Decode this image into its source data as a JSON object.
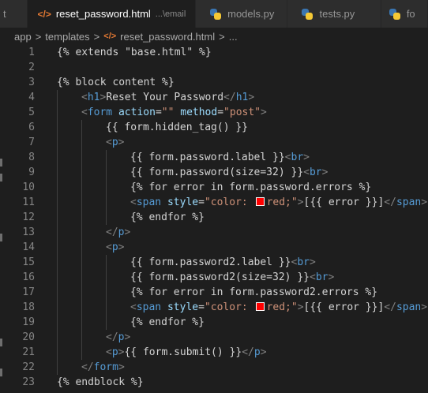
{
  "tabs": [
    {
      "label": "t",
      "icon": "",
      "hint": "",
      "active": false
    },
    {
      "label": "reset_password.html",
      "icon": "html-icon",
      "hint": "...\\email",
      "active": true
    },
    {
      "label": "models.py",
      "icon": "python-icon",
      "hint": "",
      "active": false
    },
    {
      "label": "tests.py",
      "icon": "python-icon",
      "hint": "",
      "active": false
    },
    {
      "label": "fo",
      "icon": "python-icon",
      "hint": "",
      "active": false
    }
  ],
  "breadcrumb": {
    "items": [
      "app",
      "templates",
      "reset_password.html",
      "..."
    ],
    "separator": ">"
  },
  "colors": {
    "html_tag": "#569cd6",
    "punctuation": "#808080",
    "attribute": "#9cdcfe",
    "string": "#ce9178",
    "text": "#d4d4d4",
    "line_number": "#858585",
    "color_swatch": "#ff0000"
  },
  "lines": [
    {
      "n": "1",
      "indent": 0,
      "tokens": [
        {
          "t": "{% extends \"base.html\" %}",
          "k": "txt"
        }
      ]
    },
    {
      "n": "2",
      "indent": 0,
      "tokens": []
    },
    {
      "n": "3",
      "indent": 0,
      "tokens": [
        {
          "t": "{% block content %}",
          "k": "txt"
        }
      ]
    },
    {
      "n": "4",
      "indent": 1,
      "tokens": [
        {
          "t": "<",
          "k": "punc"
        },
        {
          "t": "h1",
          "k": "tag"
        },
        {
          "t": ">",
          "k": "punc"
        },
        {
          "t": "Reset Your Password",
          "k": "txt"
        },
        {
          "t": "</",
          "k": "punc"
        },
        {
          "t": "h1",
          "k": "tag"
        },
        {
          "t": ">",
          "k": "punc"
        }
      ]
    },
    {
      "n": "5",
      "indent": 1,
      "tokens": [
        {
          "t": "<",
          "k": "punc"
        },
        {
          "t": "form",
          "k": "tag"
        },
        {
          "t": " ",
          "k": "txt"
        },
        {
          "t": "action",
          "k": "attr"
        },
        {
          "t": "=",
          "k": "txt"
        },
        {
          "t": "\"\"",
          "k": "str"
        },
        {
          "t": " ",
          "k": "txt"
        },
        {
          "t": "method",
          "k": "attr"
        },
        {
          "t": "=",
          "k": "txt"
        },
        {
          "t": "\"post\"",
          "k": "str"
        },
        {
          "t": ">",
          "k": "punc"
        }
      ]
    },
    {
      "n": "6",
      "indent": 2,
      "tokens": [
        {
          "t": "{{ form.hidden_tag() }}",
          "k": "txt"
        }
      ]
    },
    {
      "n": "7",
      "indent": 2,
      "tokens": [
        {
          "t": "<",
          "k": "punc"
        },
        {
          "t": "p",
          "k": "tag"
        },
        {
          "t": ">",
          "k": "punc"
        }
      ]
    },
    {
      "n": "8",
      "indent": 3,
      "tokens": [
        {
          "t": "{{ form.password.label }}",
          "k": "txt"
        },
        {
          "t": "<",
          "k": "punc"
        },
        {
          "t": "br",
          "k": "tag"
        },
        {
          "t": ">",
          "k": "punc"
        }
      ]
    },
    {
      "n": "9",
      "indent": 3,
      "tokens": [
        {
          "t": "{{ form.password(size=32) }}",
          "k": "txt"
        },
        {
          "t": "<",
          "k": "punc"
        },
        {
          "t": "br",
          "k": "tag"
        },
        {
          "t": ">",
          "k": "punc"
        }
      ]
    },
    {
      "n": "10",
      "indent": 3,
      "tokens": [
        {
          "t": "{% for error in form.password.errors %}",
          "k": "txt"
        }
      ]
    },
    {
      "n": "11",
      "indent": 3,
      "tokens": [
        {
          "t": "<",
          "k": "punc"
        },
        {
          "t": "span",
          "k": "tag"
        },
        {
          "t": " ",
          "k": "txt"
        },
        {
          "t": "style",
          "k": "attr"
        },
        {
          "t": "=",
          "k": "txt"
        },
        {
          "t": "\"color: ",
          "k": "str"
        },
        {
          "t": "",
          "k": "swatch"
        },
        {
          "t": "red;\"",
          "k": "str"
        },
        {
          "t": ">",
          "k": "punc"
        },
        {
          "t": "[{{ error }}]",
          "k": "txt"
        },
        {
          "t": "</",
          "k": "punc"
        },
        {
          "t": "span",
          "k": "tag"
        },
        {
          "t": ">",
          "k": "punc"
        }
      ]
    },
    {
      "n": "12",
      "indent": 3,
      "tokens": [
        {
          "t": "{% endfor %}",
          "k": "txt"
        }
      ]
    },
    {
      "n": "13",
      "indent": 2,
      "tokens": [
        {
          "t": "</",
          "k": "punc"
        },
        {
          "t": "p",
          "k": "tag"
        },
        {
          "t": ">",
          "k": "punc"
        }
      ]
    },
    {
      "n": "14",
      "indent": 2,
      "tokens": [
        {
          "t": "<",
          "k": "punc"
        },
        {
          "t": "p",
          "k": "tag"
        },
        {
          "t": ">",
          "k": "punc"
        }
      ]
    },
    {
      "n": "15",
      "indent": 3,
      "tokens": [
        {
          "t": "{{ form.password2.label }}",
          "k": "txt"
        },
        {
          "t": "<",
          "k": "punc"
        },
        {
          "t": "br",
          "k": "tag"
        },
        {
          "t": ">",
          "k": "punc"
        }
      ]
    },
    {
      "n": "16",
      "indent": 3,
      "tokens": [
        {
          "t": "{{ form.password2(size=32) }}",
          "k": "txt"
        },
        {
          "t": "<",
          "k": "punc"
        },
        {
          "t": "br",
          "k": "tag"
        },
        {
          "t": ">",
          "k": "punc"
        }
      ]
    },
    {
      "n": "17",
      "indent": 3,
      "tokens": [
        {
          "t": "{% for error in form.password2.errors %}",
          "k": "txt"
        }
      ]
    },
    {
      "n": "18",
      "indent": 3,
      "tokens": [
        {
          "t": "<",
          "k": "punc"
        },
        {
          "t": "span",
          "k": "tag"
        },
        {
          "t": " ",
          "k": "txt"
        },
        {
          "t": "style",
          "k": "attr"
        },
        {
          "t": "=",
          "k": "txt"
        },
        {
          "t": "\"color: ",
          "k": "str"
        },
        {
          "t": "",
          "k": "swatch"
        },
        {
          "t": "red;\"",
          "k": "str"
        },
        {
          "t": ">",
          "k": "punc"
        },
        {
          "t": "[{{ error }}]",
          "k": "txt"
        },
        {
          "t": "</",
          "k": "punc"
        },
        {
          "t": "span",
          "k": "tag"
        },
        {
          "t": ">",
          "k": "punc"
        }
      ]
    },
    {
      "n": "19",
      "indent": 3,
      "tokens": [
        {
          "t": "{% endfor %}",
          "k": "txt"
        }
      ]
    },
    {
      "n": "20",
      "indent": 2,
      "tokens": [
        {
          "t": "</",
          "k": "punc"
        },
        {
          "t": "p",
          "k": "tag"
        },
        {
          "t": ">",
          "k": "punc"
        }
      ]
    },
    {
      "n": "21",
      "indent": 2,
      "tokens": [
        {
          "t": "<",
          "k": "punc"
        },
        {
          "t": "p",
          "k": "tag"
        },
        {
          "t": ">",
          "k": "punc"
        },
        {
          "t": "{{ form.submit() }}",
          "k": "txt"
        },
        {
          "t": "</",
          "k": "punc"
        },
        {
          "t": "p",
          "k": "tag"
        },
        {
          "t": ">",
          "k": "punc"
        }
      ]
    },
    {
      "n": "22",
      "indent": 1,
      "tokens": [
        {
          "t": "</",
          "k": "punc"
        },
        {
          "t": "form",
          "k": "tag"
        },
        {
          "t": ">",
          "k": "punc"
        }
      ]
    },
    {
      "n": "23",
      "indent": 0,
      "tokens": [
        {
          "t": "{% endblock %}",
          "k": "txt"
        }
      ]
    }
  ]
}
